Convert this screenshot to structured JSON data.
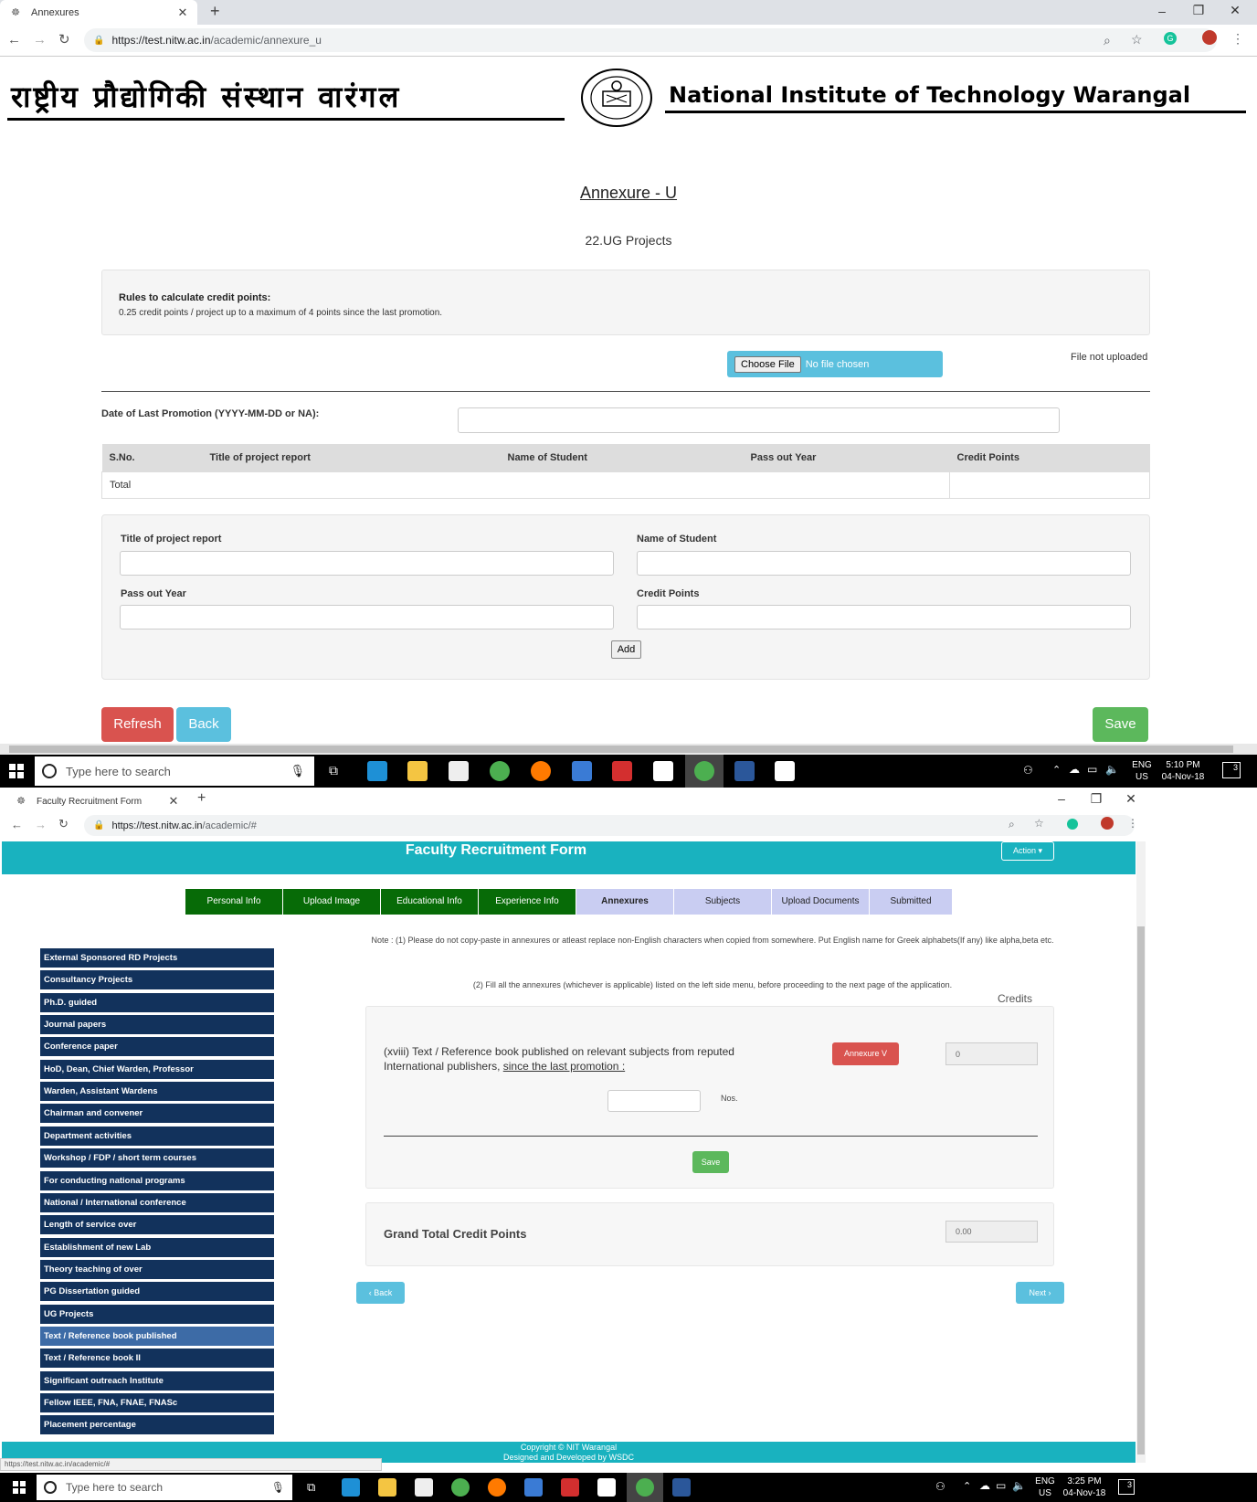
{
  "top_browser": {
    "tab_title": "Annexures",
    "url_host": "https://test.nitw.ac.in",
    "url_path": "/academic/annexure_u"
  },
  "header": {
    "hindi_name": "राष्ट्रीय प्रौद्योगिकी संस्थान वारंगल",
    "english_name": "National Institute of Technology Warangal"
  },
  "annexure": {
    "title": "Annexure - U",
    "subtitle": "22.UG Projects",
    "rules_title": "Rules to calculate credit points:",
    "rules_text": "0.25 credit points / project up to a maximum of 4 points since the last promotion.",
    "choose_file": "Choose File",
    "no_file": "No file chosen",
    "file_status": "File not uploaded",
    "date_label": "Date of Last Promotion (YYYY-MM-DD or NA):",
    "table_headers": [
      "S.No.",
      "Title of project report",
      "Name of Student",
      "Pass out Year",
      "Credit Points"
    ],
    "total_label": "Total",
    "form": {
      "title_label": "Title of project report",
      "student_label": "Name of Student",
      "year_label": "Pass out Year",
      "credit_label": "Credit Points",
      "add_label": "Add"
    },
    "buttons": {
      "refresh": "Refresh",
      "back": "Back",
      "save": "Save"
    }
  },
  "taskbar_top": {
    "search_placeholder": "Type here to search",
    "lang1": "ENG",
    "lang2": "US",
    "time": "5:10 PM",
    "date": "04-Nov-18",
    "notif": "3"
  },
  "bottom_browser": {
    "tab_title": "Faculty Recruitment Form",
    "url_host": "https://test.nitw.ac.in",
    "url_path": "/academic/#",
    "status_url": "https://test.nitw.ac.in/academic/#"
  },
  "faculty": {
    "title": "Faculty Recruitment Form",
    "action": "Action ▾",
    "steps": [
      "Personal Info",
      "Upload Image",
      "Educational Info",
      "Experience Info",
      "Annexures",
      "Subjects",
      "Upload Documents",
      "Submitted"
    ],
    "menu": [
      "External Sponsored RD Projects",
      "Consultancy Projects",
      "Ph.D. guided",
      "Journal papers",
      "Conference paper",
      "HoD, Dean, Chief Warden, Professor",
      "Warden, Assistant Wardens",
      "Chairman and convener",
      "Department activities",
      "Workshop / FDP / short term courses",
      "For conducting national programs",
      "National / International conference",
      "Length of service over",
      "Establishment of new Lab",
      "Theory teaching of over",
      "PG Dissertation guided",
      "UG Projects",
      "Text / Reference book published",
      "Text / Reference book II",
      "Significant outreach Institute",
      "Fellow IEEE, FNA, FNAE, FNASc",
      "Placement percentage"
    ],
    "note1": "Note : (1) Please do not copy-paste in annexures or atleast replace non-English characters when copied from somewhere. Put English name for Greek alphabets(If any) like alpha,beta etc.",
    "note2": "(2) Fill all the annexures (whichever is applicable) listed on the left side menu, before proceeding to the next page of the application.",
    "credits_label": "Credits",
    "item_text_a": "(xviii) Text / Reference book published on relevant subjects from reputed International publishers, ",
    "item_text_u": "since the last promotion :",
    "annexure_btn": "Annexure V",
    "credit_value": "0",
    "nos_label": "Nos.",
    "save": "Save",
    "grand_label": "Grand Total Credit Points",
    "grand_value": "0.00",
    "back": "‹ Back",
    "next": "Next ›",
    "footer1": "Copyright © NIT Warangal",
    "footer2": "Designed and Developed by WSDC"
  },
  "taskbar_bottom": {
    "search_placeholder": "Type here to search",
    "lang1": "ENG",
    "lang2": "US",
    "time": "3:25 PM",
    "date": "04-Nov-18",
    "notif": "3"
  },
  "colors": {
    "teal": "#19b2bf",
    "navy": "#12325c",
    "green_step": "#076b07",
    "lav_step": "#c9cdf2",
    "red": "#d9534f",
    "info": "#5bc0de",
    "success": "#5cb85c"
  }
}
